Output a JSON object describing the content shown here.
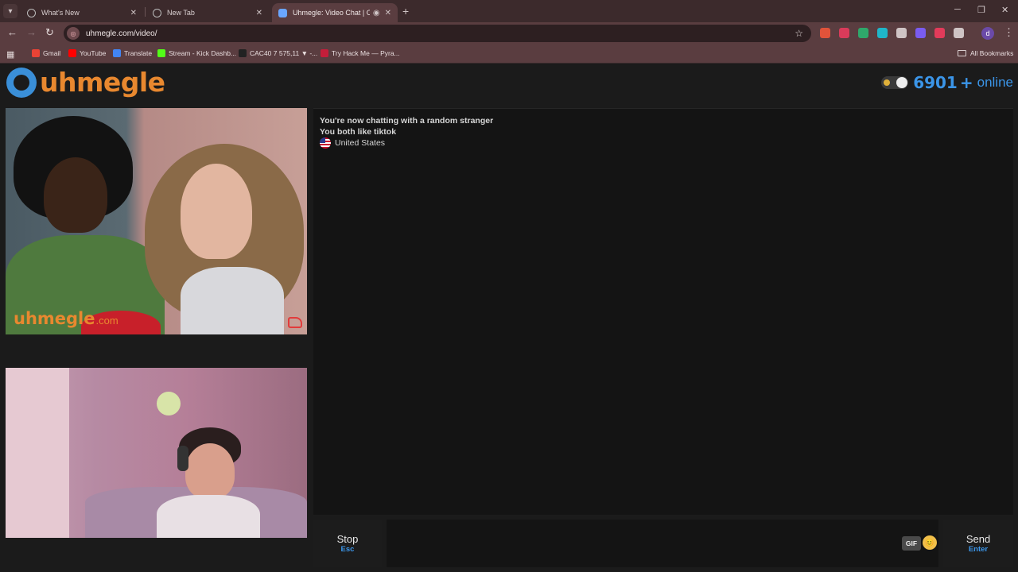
{
  "browser": {
    "tabs": [
      {
        "title": "What's New",
        "active": false
      },
      {
        "title": "New Tab",
        "active": false
      },
      {
        "title": "Uhmegle: Video Chat | Ome",
        "active": true
      }
    ],
    "url": "uhmegle.com/video/",
    "bookmarks": [
      {
        "label": "Gmail",
        "color": "#ea4335"
      },
      {
        "label": "YouTube",
        "color": "#ff0000"
      },
      {
        "label": "Translate",
        "color": "#4285f4"
      },
      {
        "label": "Stream - Kick Dashb...",
        "color": "#53fc18"
      },
      {
        "label": "CAC40 7 575,11 ▼ -...",
        "color": "#222222"
      },
      {
        "label": "Try Hack Me — Pyra...",
        "color": "#c41e3a"
      }
    ],
    "all_bookmarks_label": "All Bookmarks",
    "profile_initial": "d",
    "extension_colors": [
      "#e0533a",
      "#d93b5a",
      "#2fa86b",
      "#1fb6c9",
      "#cfc4c5",
      "#7a5cf0",
      "#e23b5a",
      "#cfc4c5"
    ]
  },
  "site": {
    "logo_text": "uhmegle",
    "online_count": "6901",
    "online_plus": "+",
    "online_label": "online",
    "accent": "#3b95e8",
    "brand_orange": "#e8882f"
  },
  "stranger_video": {
    "watermark": "uhmegle",
    "watermark_tld": ".com"
  },
  "chat": {
    "messages": [
      "You're now chatting with a random stranger",
      "You both like tiktok"
    ],
    "country": "United States"
  },
  "controls": {
    "stop_label": "Stop",
    "stop_key": "Esc",
    "gif_label": "GIF",
    "emoji": "😊",
    "send_label": "Send",
    "send_key": "Enter",
    "message_placeholder": ""
  }
}
